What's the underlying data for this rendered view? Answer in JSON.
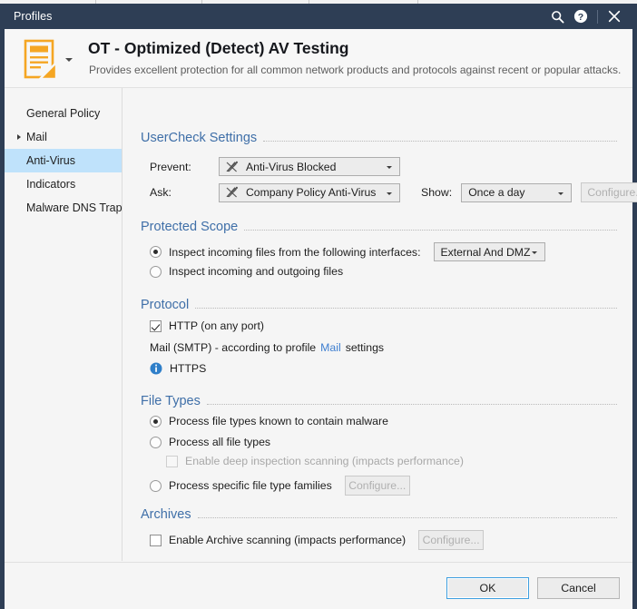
{
  "titlebar": {
    "title": "Profiles",
    "icons": [
      {
        "name": "search-icon",
        "glyph": "search"
      },
      {
        "name": "help-icon",
        "glyph": "help"
      },
      {
        "name": "close-icon",
        "glyph": "close"
      }
    ]
  },
  "header": {
    "profile_icon": "document-edit-icon",
    "title": "OT - Optimized (Detect)  AV Testing",
    "subtitle": "Provides excellent protection for all common network products and protocols against recent or popular attacks."
  },
  "sidebar": {
    "items": [
      {
        "label": "General Policy",
        "selected": false,
        "expandable": false
      },
      {
        "label": "Mail",
        "selected": false,
        "expandable": true
      },
      {
        "label": "Anti-Virus",
        "selected": true,
        "expandable": false
      },
      {
        "label": "Indicators",
        "selected": false,
        "expandable": false
      },
      {
        "label": "Malware DNS Trap",
        "selected": false,
        "expandable": false
      }
    ]
  },
  "sections": {
    "usercheck": {
      "title": "UserCheck Settings",
      "prevent_label": "Prevent:",
      "prevent_value": "Anti-Virus Blocked",
      "ask_label": "Ask:",
      "ask_value": "Company Policy Anti-Virus",
      "show_label": "Show:",
      "show_value": "Once a day",
      "configure_label": "Configure.."
    },
    "protected_scope": {
      "title": "Protected Scope",
      "option_interfaces": "Inspect incoming files from the following interfaces:",
      "interfaces_value": "External And DMZ",
      "option_both": "Inspect incoming and outgoing files"
    },
    "protocol": {
      "title": "Protocol",
      "http_label": "HTTP (on any port)",
      "smtp_prefix": "Mail (SMTP) - according to profile",
      "smtp_link": "Mail",
      "smtp_suffix": "settings",
      "https_label": "HTTPS"
    },
    "file_types": {
      "title": "File Types",
      "option_known": "Process file types known to contain malware",
      "option_all": "Process all file types",
      "deep_inspection": "Enable deep inspection scanning (impacts performance)",
      "option_specific": "Process specific file type families",
      "configure_label": "Configure..."
    },
    "archives": {
      "title": "Archives",
      "enable_label": "Enable Archive scanning (impacts performance)",
      "configure_label": "Configure..."
    }
  },
  "footer": {
    "ok_label": "OK",
    "cancel_label": "Cancel"
  },
  "colors": {
    "titlebar_bg": "#2e3e55",
    "section_heading": "#3f6fa8",
    "selection": "#bfe2fb",
    "accent_icon": "#f5a623",
    "link": "#3f7fd0"
  }
}
